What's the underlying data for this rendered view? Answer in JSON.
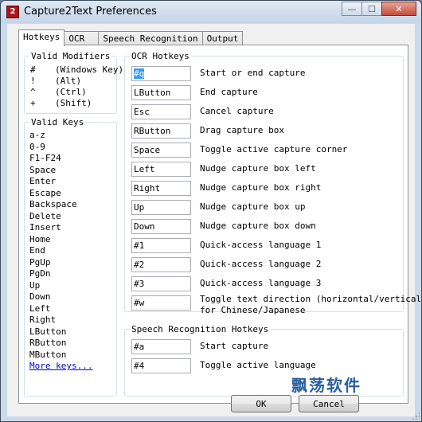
{
  "window": {
    "title": "Capture2Text Preferences",
    "icon_text": "2",
    "buttons": {
      "minimize": "—",
      "maximize": "☐",
      "close": "✕"
    }
  },
  "tabs": [
    {
      "label": "Hotkeys",
      "active": true
    },
    {
      "label": "OCR",
      "active": false
    },
    {
      "label": "Speech Recognition",
      "active": false
    },
    {
      "label": "Output",
      "active": false
    }
  ],
  "valid_modifiers": {
    "title": "Valid Modifiers",
    "items": [
      {
        "symbol": "#",
        "desc": "(Windows Key)"
      },
      {
        "symbol": "!",
        "desc": "(Alt)"
      },
      {
        "symbol": "^",
        "desc": "(Ctrl)"
      },
      {
        "symbol": "+",
        "desc": "(Shift)"
      }
    ]
  },
  "valid_keys": {
    "title": "Valid Keys",
    "items": [
      "a-z",
      "0-9",
      "F1-F24",
      "Space",
      "Enter",
      "Escape",
      "Backspace",
      "Delete",
      "Insert",
      "Home",
      "End",
      "PgUp",
      "PgDn",
      "Up",
      "Down",
      "Left",
      "Right",
      "LButton",
      "RButton",
      "MButton"
    ],
    "more_link": "More keys..."
  },
  "ocr_hotkeys": {
    "title": "OCR Hotkeys",
    "rows": [
      {
        "value": "#q",
        "label": "Start or end capture",
        "selected": true
      },
      {
        "value": "LButton",
        "label": "End capture"
      },
      {
        "value": "Esc",
        "label": "Cancel capture"
      },
      {
        "value": "RButton",
        "label": "Drag capture box"
      },
      {
        "value": "Space",
        "label": "Toggle active capture corner"
      },
      {
        "value": "Left",
        "label": "Nudge capture box left"
      },
      {
        "value": "Right",
        "label": "Nudge capture box right"
      },
      {
        "value": "Up",
        "label": "Nudge capture box up"
      },
      {
        "value": "Down",
        "label": "Nudge capture box down"
      },
      {
        "value": "#1",
        "label": "Quick-access language 1"
      },
      {
        "value": "#2",
        "label": "Quick-access language 2"
      },
      {
        "value": "#3",
        "label": "Quick-access language 3"
      },
      {
        "value": "#w",
        "label": "Toggle text direction (horizontal/vertical)",
        "label2": "for Chinese/Japanese"
      }
    ]
  },
  "speech_hotkeys": {
    "title": "Speech Recognition Hotkeys",
    "rows": [
      {
        "value": "#a",
        "label": "Start capture"
      },
      {
        "value": "#4",
        "label": "Toggle active language"
      }
    ]
  },
  "footer": {
    "ok_label": "OK",
    "cancel_label": "Cancel"
  },
  "watermark": "飘荡软件"
}
